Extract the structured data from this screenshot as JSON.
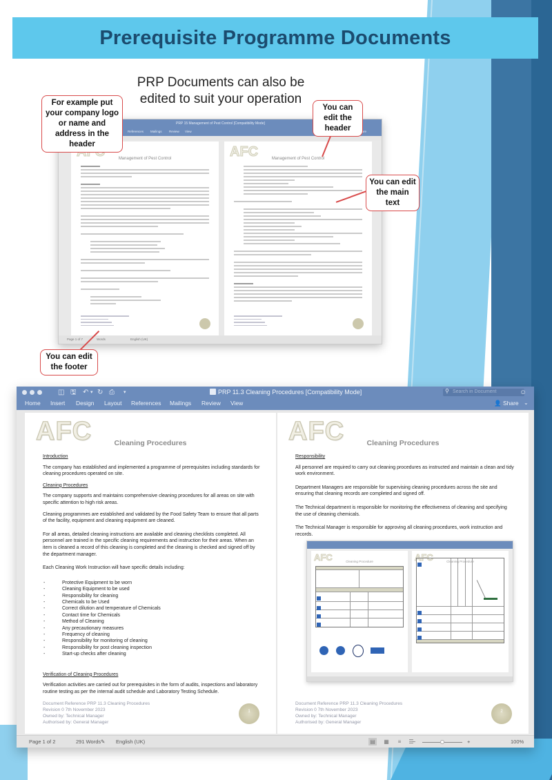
{
  "banner": {
    "title": "Prerequisite Programme Documents"
  },
  "subtitle": {
    "line1": "PRP Documents can also be",
    "line2": "edited to suit your operation"
  },
  "callouts": {
    "header_logo": "For example put your company logo or name and address in the header",
    "edit_header": "You can edit the header",
    "edit_main_text": "You can edit the main text",
    "edit_footer": "You can edit the footer"
  },
  "small_window": {
    "title": "PRP 15 Management of Pest Control [Compatibility Mode]",
    "ribbon_tabs": [
      "References",
      "Mailings",
      "Review",
      "View"
    ],
    "share_label": "Share",
    "page_heading": "Management of Pest Control",
    "logo_text": "AFC",
    "status": {
      "page": "Page 1 of 7",
      "words": "Words",
      "language": "English (UK)"
    }
  },
  "window": {
    "title": "PRP 11.3 Cleaning Procedures [Compatibility Mode]",
    "search_placeholder": "Search in Document",
    "ribbon_tabs": [
      "Home",
      "Insert",
      "Design",
      "Layout",
      "References",
      "Mailings",
      "Review",
      "View"
    ],
    "share_label": "Share",
    "icons": {
      "sidebar": "sidebar-toggle-icon",
      "save": "save-icon",
      "undo": "undo-icon",
      "redo": "redo-icon",
      "print": "print-icon",
      "customize": "chevron-down-icon",
      "search": "search-icon",
      "account": "smiley-account-icon",
      "share": "person-add-icon"
    },
    "status": {
      "page": "Page 1 of 2",
      "words": "291 Words",
      "language": "English (UK)",
      "zoom_minus": "−",
      "zoom_plus": "+",
      "zoom_level": "100%",
      "zoom_fraction": 0.5
    }
  },
  "left_page": {
    "logo_text": "AFC",
    "heading": "Cleaning Procedures",
    "sections": {
      "intro_title": "Introduction",
      "intro_text": "The company has established and implemented a programme of prerequisites including standards for cleaning procedures operated on site.",
      "cleaning_title": "Cleaning Procedures",
      "p1": "The company supports and maintains comprehensive cleaning procedures for all areas on site with specific attention to high risk areas.",
      "p2": "Cleaning programmes are established and validated by the Food Safety Team to ensure that all parts of the facility, equipment and cleaning equipment are cleaned.",
      "p3": "For all areas, detailed cleaning instructions are available and cleaning checklists completed. All personnel are trained in the specific cleaning requirements and instruction for their areas. When an item is cleaned a record of this cleaning is completed and the cleaning is checked and signed off by the department manager.",
      "p4": "Each Cleaning Work Instruction will have specific details including:",
      "list": [
        "Protective Equipment to be worn",
        "Cleaning Equipment to be used",
        "Responsibility for cleaning",
        "Chemicals to be Used",
        "Correct dilution and temperature of Chemicals",
        "Contact time for Chemicals",
        "Method of Cleaning",
        "Any precautionary measures",
        "Frequency of cleaning",
        "Responsibility for monitoring of cleaning",
        "Responsibility for post cleaning inspection",
        "Start-up checks after cleaning"
      ],
      "verification_title": "Verification of Cleaning Procedures",
      "verification_text": "Verification activities are carried out for prerequisites in the form of audits, inspections and laboratory routine testing as per the internal audit schedule and Laboratory Testing Schedule."
    },
    "footer": {
      "ref": "Document Reference PRP 11.3 Cleaning Procedures",
      "revision": "Revision 0   7th November 2023",
      "owner": "Owned by: Technical Manager",
      "authorised": "Authorised by: General Manager"
    },
    "page_number": "1"
  },
  "right_page": {
    "logo_text": "AFC",
    "heading": "Cleaning Procedures",
    "responsibility_title": "Responsibility",
    "paragraphs": [
      "All personnel are required to carry out cleaning procedures as instructed and maintain a clean and tidy work environment.",
      "Department Managers are responsible for supervising cleaning procedures across the site and ensuring that cleaning records are completed and signed off.",
      "The Technical department is responsible for monitoring the effectiveness of cleaning and specifying the use of cleaning chemicals.",
      " The Technical Manager is responsible for approving all cleaning procedures, work instruction and records."
    ],
    "embedded_image": {
      "heading": "Cleaning Procedure",
      "logo_text": "AFC"
    },
    "footer": {
      "ref": "Document Reference PRP 11.3 Cleaning Procedures",
      "revision": "Revision 0   7th November 2023",
      "owner": "Owned by: Technical Manager",
      "authorised": "Authorised by: General Manager"
    },
    "page_number": "2"
  }
}
